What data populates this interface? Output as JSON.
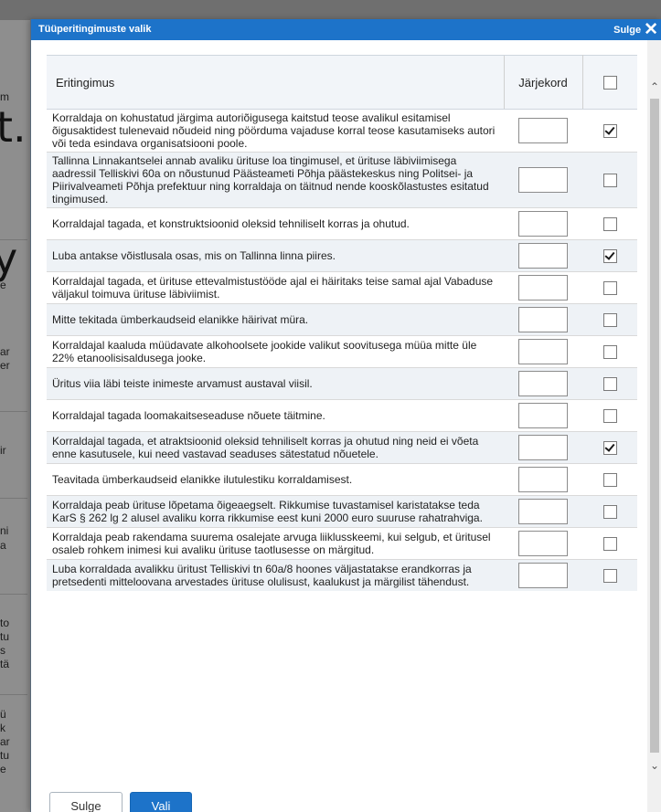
{
  "dialog": {
    "title": "Tüüperitingimuste valik",
    "close_label": "Sulge"
  },
  "table": {
    "headers": {
      "condition": "Eritingimus",
      "order": "Järjekord"
    },
    "rows": [
      {
        "text": "Korraldaja on kohustatud järgima autoriõigusega kaitstud teose avalikul esitamisel õigusaktidest tulenevaid nõudeid ning pöörduma vajaduse korral teose kasutamiseks autori või teda esindava organisatsiooni poole.",
        "order": "",
        "checked": true
      },
      {
        "text": "Tallinna Linnakantselei annab avaliku ürituse loa tingimusel, et ürituse läbiviimisega aadressil Telliskivi 60a on nõustunud Päästeameti Põhja päästekeskus ning Politsei- ja Piirivalveameti Põhja prefektuur ning korraldaja on täitnud nende kooskõlastustes esitatud tingimused.",
        "order": "",
        "checked": false
      },
      {
        "text": "Korraldajal tagada, et konstruktsioonid oleksid tehniliselt korras ja ohutud.",
        "order": "",
        "checked": false
      },
      {
        "text": "Luba antakse võistlusala osas, mis on Tallinna linna piires.",
        "order": "",
        "checked": true
      },
      {
        "text": "Korraldajal tagada, et ürituse ettevalmistustööde ajal ei häiritaks teise samal ajal Vabaduse väljakul toimuva ürituse läbiviimist.",
        "order": "",
        "checked": false
      },
      {
        "text": "Mitte tekitada ümberkaudseid elanikke häirivat müra.",
        "order": "",
        "checked": false
      },
      {
        "text": "Korraldajal kaaluda müüdavate alkohoolsete jookide valikut soovitusega müüa mitte üle 22% etanoolisisaldusega jooke.",
        "order": "",
        "checked": false
      },
      {
        "text": "Üritus viia läbi teiste inimeste arvamust austaval viisil.",
        "order": "",
        "checked": false
      },
      {
        "text": "Korraldajal tagada loomakaitseseaduse nõuete täitmine.",
        "order": "",
        "checked": false
      },
      {
        "text": "Korraldajal tagada, et atraktsioonid oleksid tehniliselt korras ja ohutud ning neid ei võeta enne kasutusele, kui need vastavad seaduses sätestatud nõuetele.",
        "order": "",
        "checked": true
      },
      {
        "text": "Teavitada ümberkaudseid elanikke ilutulestiku korraldamisest.",
        "order": "",
        "checked": false
      },
      {
        "text": "Korraldaja peab ürituse lõpetama õigeaegselt. Rikkumise tuvastamisel karistatakse teda KarS § 262 lg 2 alusel avaliku korra rikkumise eest kuni 2000 euro suuruse rahatrahviga.",
        "order": "",
        "checked": false
      },
      {
        "text": "Korraldaja peab rakendama suurema osalejate arvuga liiklusskeemi, kui selgub, et üritusel osaleb rohkem inimesi kui avaliku ürituse taotlusesse on märgitud.",
        "order": "",
        "checked": false
      },
      {
        "text": "Luba korraldada avalikku üritust Telliskivi tn 60a/8 hoones väljastatakse erandkorras ja pretsedenti mitteloovana arvestades ürituse olulisust, kaalukust ja märgilist tähendust.",
        "order": "",
        "checked": false
      }
    ]
  },
  "buttons": {
    "cancel": "Sulge",
    "select": "Vali"
  },
  "background": {
    "big_glyphs": [
      "t.",
      "y"
    ],
    "fragments": [
      "m",
      "e",
      "ar",
      "er",
      "ir",
      "ni",
      "a",
      "to",
      "tu",
      "s",
      "tä",
      "ü",
      "k",
      "ar",
      "tu",
      "e"
    ]
  },
  "colors": {
    "titlebar": "#1d73c9",
    "row_alt": "#eef2f6",
    "overlay": "#8e8e8e"
  }
}
